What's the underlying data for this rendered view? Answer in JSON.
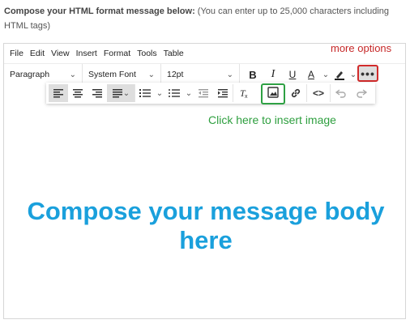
{
  "instructions": {
    "bold": "Compose your HTML format message below:",
    "rest": " (You can enter up to 25,000 characters including HTML tags)"
  },
  "menubar": [
    "File",
    "Edit",
    "View",
    "Insert",
    "Format",
    "Tools",
    "Table"
  ],
  "toolbar": {
    "block_format": "Paragraph",
    "font_family": "System Font",
    "font_size": "12pt",
    "bold": "B",
    "italic": "I",
    "underline": "U",
    "text_color": "A",
    "more": "•••"
  },
  "annotations": {
    "more_options": "more options",
    "insert_image": "Click here to insert image",
    "compose_body": "Compose your message body here"
  },
  "colors": {
    "annotation_red": "#d12b2b",
    "annotation_green": "#2e9f3f",
    "compose_blue": "#1aa0dc"
  },
  "icons": [
    "align-left-icon",
    "align-center-icon",
    "align-right-icon",
    "align-justify-icon",
    "numbered-list-icon",
    "bullet-list-icon",
    "outdent-icon",
    "indent-icon",
    "clear-format-icon",
    "image-icon",
    "link-icon",
    "code-icon",
    "undo-icon",
    "redo-icon",
    "highlight-icon"
  ]
}
